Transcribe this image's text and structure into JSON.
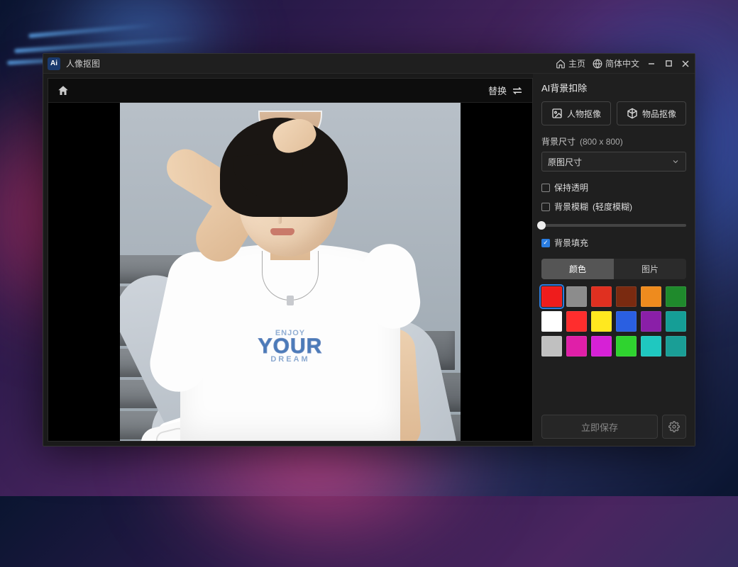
{
  "titlebar": {
    "app_icon_text": "Ai",
    "title": "人像抠图",
    "home_link": "主页",
    "language": "简体中文"
  },
  "canvas": {
    "replace_label": "替换",
    "print_line1": "ENJOY",
    "print_line2": "YOUR",
    "print_line3": "DREAM"
  },
  "sidebar": {
    "panel_title": "AI背景扣除",
    "mode_person": "人物抠像",
    "mode_object": "物品抠像",
    "bg_size_label": "背景尺寸",
    "bg_size_value": "(800 x 800)",
    "size_select": "原图尺寸",
    "keep_transparent": "保持透明",
    "bg_blur_label": "背景模糊",
    "bg_blur_hint": "(轻度模糊)",
    "bg_fill": "背景填充",
    "tab_color": "颜色",
    "tab_image": "图片",
    "swatches": [
      "#ef1c1c",
      "#8c8c8c",
      "#e03020",
      "#7a2a10",
      "#ee8b1e",
      "#1f8a2c",
      "#ffffff",
      "#ff2d2d",
      "#ffe81f",
      "#2a5fe1",
      "#8a1fa8",
      "#159e96",
      "#c0c0c0",
      "#e01fa8",
      "#d621d6",
      "#2fd32f",
      "#1fc8c0",
      "#1a9e96"
    ],
    "save_label": "立即保存"
  }
}
